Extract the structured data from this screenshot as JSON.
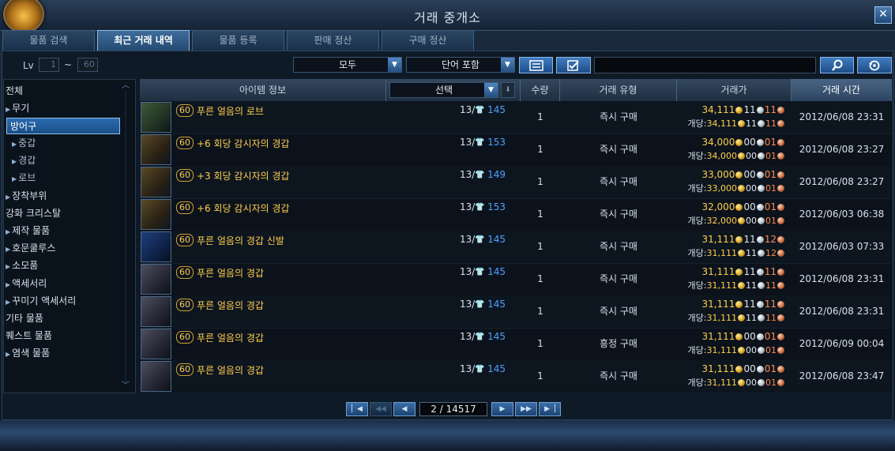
{
  "window": {
    "title": "거래 중개소",
    "close_label": "✕"
  },
  "tabs": [
    "물품 검색",
    "최근 거래 내역",
    "물품 등록",
    "판매 정산",
    "구매 정산"
  ],
  "filters": {
    "lv_label": "Lv",
    "lv_min": "1",
    "lv_sep": "~",
    "lv_max": "60",
    "category_dropdown": "모두",
    "match_dropdown": "단어 포함",
    "search_placeholder": ""
  },
  "sidebar": {
    "items": [
      {
        "label": "전체",
        "sub": false,
        "arrow": false,
        "selected": false
      },
      {
        "label": "무기",
        "sub": false,
        "arrow": true,
        "selected": false
      },
      {
        "label": "방어구",
        "sub": false,
        "arrow": false,
        "selected": true
      },
      {
        "label": "중갑",
        "sub": true,
        "arrow": true,
        "selected": false
      },
      {
        "label": "경갑",
        "sub": true,
        "arrow": true,
        "selected": false
      },
      {
        "label": "로브",
        "sub": true,
        "arrow": true,
        "selected": false
      },
      {
        "label": "장착부위",
        "sub": false,
        "arrow": true,
        "selected": false
      },
      {
        "label": "강화 크리스탈",
        "sub": false,
        "arrow": false,
        "selected": false
      },
      {
        "label": "제작 물품",
        "sub": false,
        "arrow": true,
        "selected": false
      },
      {
        "label": "호문쿨루스",
        "sub": false,
        "arrow": true,
        "selected": false
      },
      {
        "label": "소모품",
        "sub": false,
        "arrow": true,
        "selected": false
      },
      {
        "label": "액세서리",
        "sub": false,
        "arrow": true,
        "selected": false
      },
      {
        "label": "꾸미기 액세서리",
        "sub": false,
        "arrow": true,
        "selected": false
      },
      {
        "label": "기타 물품",
        "sub": false,
        "arrow": false,
        "selected": false
      },
      {
        "label": "퀘스트 물품",
        "sub": false,
        "arrow": false,
        "selected": false
      },
      {
        "label": "염색 물품",
        "sub": false,
        "arrow": true,
        "selected": false
      }
    ]
  },
  "table": {
    "headers": {
      "item_info": "아이템 정보",
      "select": "선택",
      "quantity": "수량",
      "trade_type": "거래 유형",
      "price": "거래가",
      "time": "거래 시간"
    },
    "unit_price_label": "개당:",
    "rows": [
      {
        "icon": "robe-armor-icon",
        "icon_style": "green",
        "level": "60",
        "name": "푸른 얼음의 로브",
        "dur_cur": "13/",
        "dur_max": "145",
        "qty": "1",
        "type": "즉시 구매",
        "price_gold": "34,111",
        "price_silver": "11",
        "price_copper": "11",
        "unit_gold": "34,111",
        "unit_silver": "11",
        "unit_copper": "11",
        "time": "2012/06/08 23:31"
      },
      {
        "icon": "leather-armor-icon",
        "icon_style": "gold",
        "level": "60",
        "name": "+6 회당 감시자의 경갑",
        "dur_cur": "13/",
        "dur_max": "153",
        "qty": "1",
        "type": "즉시 구매",
        "price_gold": "34,000",
        "price_silver": "00",
        "price_copper": "01",
        "unit_gold": "34,000",
        "unit_silver": "00",
        "unit_copper": "01",
        "time": "2012/06/08 23:27"
      },
      {
        "icon": "leather-armor-icon",
        "icon_style": "gold",
        "level": "60",
        "name": "+3 회당 감시자의 경갑",
        "dur_cur": "13/",
        "dur_max": "149",
        "qty": "1",
        "type": "즉시 구매",
        "price_gold": "33,000",
        "price_silver": "00",
        "price_copper": "01",
        "unit_gold": "33,000",
        "unit_silver": "00",
        "unit_copper": "01",
        "time": "2012/06/08 23:27"
      },
      {
        "icon": "leather-armor-icon",
        "icon_style": "gold",
        "level": "60",
        "name": "+6 회당 감시자의 경갑",
        "dur_cur": "13/",
        "dur_max": "153",
        "qty": "1",
        "type": "즉시 구매",
        "price_gold": "32,000",
        "price_silver": "00",
        "price_copper": "01",
        "unit_gold": "32,000",
        "unit_silver": "00",
        "unit_copper": "01",
        "time": "2012/06/03 06:38"
      },
      {
        "icon": "boots-icon",
        "icon_style": "blue",
        "level": "60",
        "name": "푸른 얼음의 경갑 신발",
        "dur_cur": "13/",
        "dur_max": "145",
        "qty": "1",
        "type": "즉시 구매",
        "price_gold": "31,111",
        "price_silver": "11",
        "price_copper": "12",
        "unit_gold": "31,111",
        "unit_silver": "11",
        "unit_copper": "12",
        "time": "2012/06/03 07:33"
      },
      {
        "icon": "chest-armor-icon",
        "icon_style": "steel",
        "level": "60",
        "name": "푸른 얼음의 경갑",
        "dur_cur": "13/",
        "dur_max": "145",
        "qty": "1",
        "type": "즉시 구매",
        "price_gold": "31,111",
        "price_silver": "11",
        "price_copper": "11",
        "unit_gold": "31,111",
        "unit_silver": "11",
        "unit_copper": "11",
        "time": "2012/06/08 23:31"
      },
      {
        "icon": "chest-armor-icon",
        "icon_style": "steel",
        "level": "60",
        "name": "푸른 얼음의 경갑",
        "dur_cur": "13/",
        "dur_max": "145",
        "qty": "1",
        "type": "즉시 구매",
        "price_gold": "31,111",
        "price_silver": "11",
        "price_copper": "11",
        "unit_gold": "31,111",
        "unit_silver": "11",
        "unit_copper": "11",
        "time": "2012/06/08 23:31"
      },
      {
        "icon": "chest-armor-icon",
        "icon_style": "steel",
        "level": "60",
        "name": "푸른 얼음의 경갑",
        "dur_cur": "13/",
        "dur_max": "145",
        "qty": "1",
        "type": "흥정 구매",
        "price_gold": "31,111",
        "price_silver": "00",
        "price_copper": "01",
        "unit_gold": "31,111",
        "unit_silver": "00",
        "unit_copper": "01",
        "time": "2012/06/09 00:04"
      },
      {
        "icon": "chest-armor-icon",
        "icon_style": "steel",
        "level": "60",
        "name": "푸른 얼음의 경갑",
        "dur_cur": "13/",
        "dur_max": "145",
        "qty": "1",
        "type": "즉시 구매",
        "price_gold": "31,111",
        "price_silver": "00",
        "price_copper": "01",
        "unit_gold": "31,111",
        "unit_silver": "00",
        "unit_copper": "01",
        "time": "2012/06/08 23:47"
      }
    ]
  },
  "pager": {
    "current": "2",
    "separator": "/",
    "total": "14517"
  },
  "colors": {
    "accent": "#2a6cb0",
    "item_name": "#ffcf4a",
    "durability": "#4aa3ff",
    "copper": "#ff8a4a"
  }
}
